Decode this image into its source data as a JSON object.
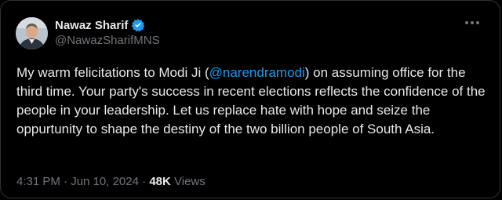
{
  "tweet": {
    "author_name": "Nawaz Sharif",
    "handle": "@NawazSharifMNS",
    "text_before": "My warm felicitations to Modi Ji (",
    "mention": "@narendramodi",
    "text_after": ") on assuming office for the third time. Your party's success in recent elections reflects the confidence of the people in your leadership. Let us replace hate with hope and seize the oppurtunity to shape the destiny of the two billion people of South Asia.",
    "time": "4:31 PM",
    "date": "Jun 10, 2024",
    "separator": "·",
    "views_count": "48K",
    "views_label": "Views"
  },
  "icons": {
    "verified": "verified-badge-icon",
    "more": "more-options-icon"
  },
  "colors": {
    "background": "#000000",
    "text": "#e7e9ea",
    "muted": "#71767b",
    "accent": "#1d9bf0",
    "border": "#2f3336"
  }
}
